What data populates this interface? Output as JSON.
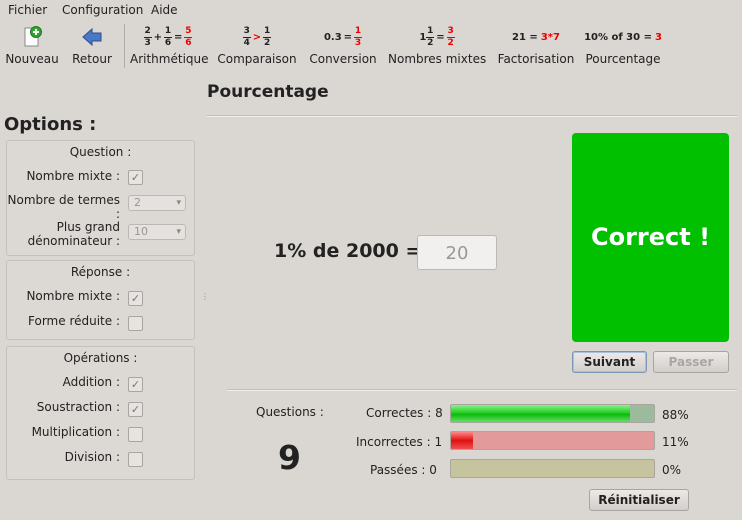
{
  "menu": {
    "file": "Fichier",
    "config": "Configuration",
    "help": "Aide"
  },
  "toolbar": {
    "new": "Nouveau",
    "back": "Retour",
    "arithmetic": "Arithmétique",
    "comparison": "Comparaison",
    "conversion": "Conversion",
    "mixed": "Nombres mixtes",
    "factorization": "Factorisation",
    "percentage": "Pourcentage",
    "conv_left": "0.3",
    "conv_eq": "=",
    "fact_left": "21 =",
    "fact_right": "3*7",
    "pct_left": "10% of 30 =",
    "pct_right": "3"
  },
  "page_title": "Pourcentage",
  "options": {
    "title": "Options :",
    "question": {
      "title": "Question :",
      "mixed_number": "Nombre mixte :",
      "term_count": "Nombre de termes :",
      "term_count_value": "2",
      "largest_denominator": "Plus grand dénominateur :",
      "largest_denominator_value": "10"
    },
    "answer": {
      "title": "Réponse :",
      "mixed_number": "Nombre mixte :",
      "reduced_form": "Forme réduite :"
    },
    "operations": {
      "title": "Opérations :",
      "addition": "Addition :",
      "subtraction": "Soustraction :",
      "multiplication": "Multiplication :",
      "division": "Division :"
    }
  },
  "exercise": {
    "question": "1% de 2000 =",
    "answer_value": "20",
    "result": "Correct !",
    "next": "Suivant",
    "skip": "Passer"
  },
  "stats": {
    "questions_label": "Questions :",
    "questions_count": "9",
    "correct_label": "Correctes : 8",
    "correct_pct": "88%",
    "correct_fraction": 0.88,
    "incorrect_label": "Incorrectes : 1",
    "incorrect_pct": "11%",
    "incorrect_fraction": 0.11,
    "skipped_label": "Passées : 0",
    "skipped_pct": "0%",
    "skipped_fraction": 0,
    "reset": "Réinitialiser"
  },
  "colors": {
    "correct": "#00c000",
    "error": "#e00000"
  }
}
